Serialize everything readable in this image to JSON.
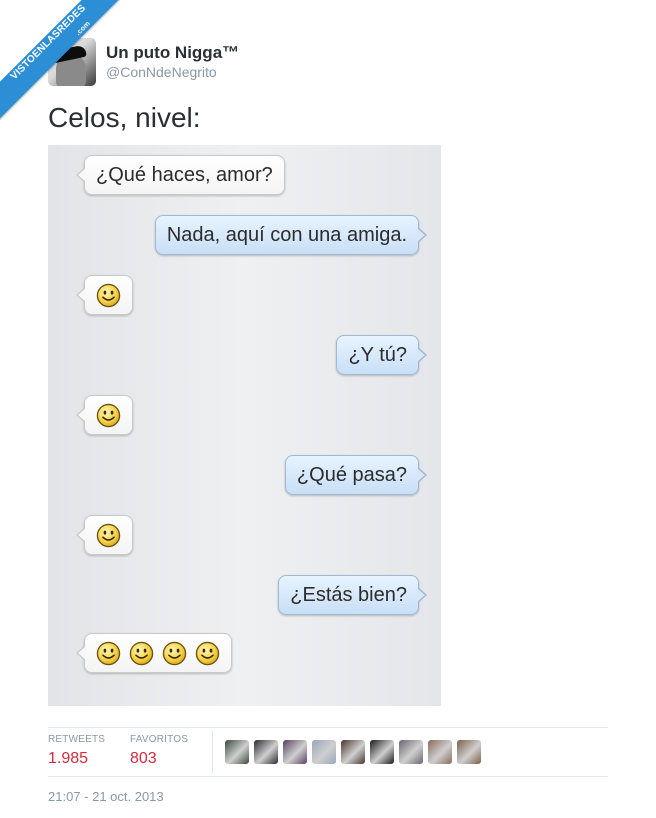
{
  "watermark": {
    "site": "VISTOENLASREDES",
    "suffix": ".com"
  },
  "author": {
    "display_name": "Un puto Nigga™",
    "handle": "@ConNdeNegrito"
  },
  "tweet": {
    "text": "Celos, nivel:"
  },
  "chat": {
    "messages": [
      {
        "side": "in",
        "text": "¿Qué haces, amor?"
      },
      {
        "side": "out",
        "text": "Nada, aquí con una amiga."
      },
      {
        "side": "in",
        "smileys": 1
      },
      {
        "side": "out",
        "text": "¿Y tú?"
      },
      {
        "side": "in",
        "smileys": 1
      },
      {
        "side": "out",
        "text": "¿Qué pasa?"
      },
      {
        "side": "in",
        "smileys": 1
      },
      {
        "side": "out",
        "text": "¿Estás bien?"
      },
      {
        "side": "in",
        "smileys": 4
      }
    ]
  },
  "stats": {
    "retweets_label": "RETWEETS",
    "retweets": "1.985",
    "favorites_label": "FAVORITOS",
    "favorites": "803"
  },
  "favoriters": [
    "#3b4a3f",
    "#2a2a33",
    "#5a4060",
    "#9aa6b8",
    "#4a3530",
    "#1a1a1a",
    "#6b6570",
    "#8a6a5a",
    "#7a5f4a"
  ],
  "timestamp": "21:07 - 21 oct. 2013",
  "colors": {
    "accent_red": "#d62a3e",
    "muted": "#8899a6",
    "ribbon": "#2c8fd6"
  }
}
